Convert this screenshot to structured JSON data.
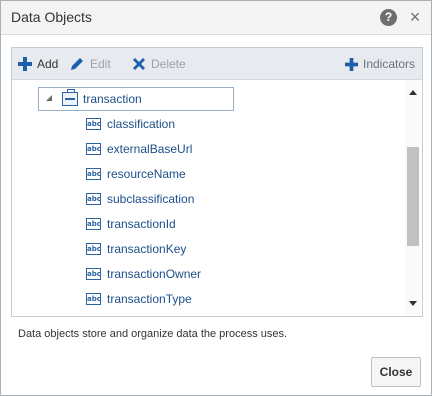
{
  "dialog": {
    "title": "Data Objects",
    "help_icon": "?",
    "close_icon": "×"
  },
  "toolbar": {
    "add_label": "Add",
    "edit_label": "Edit",
    "delete_label": "Delete",
    "indicators_label": "Indicators"
  },
  "tree": {
    "parent": {
      "label": "transaction",
      "icon": "data-object-icon",
      "expanded": true
    },
    "children": [
      {
        "label": "classification",
        "icon": "string-type-icon"
      },
      {
        "label": "externalBaseUrl",
        "icon": "string-type-icon"
      },
      {
        "label": "resourceName",
        "icon": "string-type-icon"
      },
      {
        "label": "subclassification",
        "icon": "string-type-icon"
      },
      {
        "label": "transactionId",
        "icon": "string-type-icon"
      },
      {
        "label": "transactionKey",
        "icon": "string-type-icon"
      },
      {
        "label": "transactionOwner",
        "icon": "string-type-icon"
      },
      {
        "label": "transactionType",
        "icon": "string-type-icon"
      }
    ],
    "type_badge": "abc"
  },
  "footer": {
    "description": "Data objects store and organize data the process uses.",
    "close_label": "Close"
  },
  "colors": {
    "accent": "#1c5fab",
    "tree_text": "#1c4f88",
    "disabled": "#9aa3ab"
  }
}
